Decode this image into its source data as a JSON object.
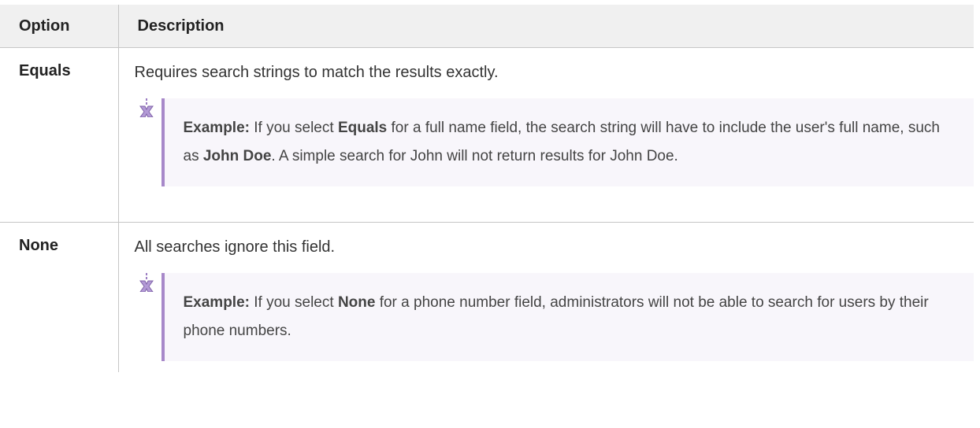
{
  "table": {
    "headers": {
      "option": "Option",
      "description": "Description"
    },
    "rows": [
      {
        "option": "Equals",
        "description": "Requires search strings to match the results exactly.",
        "note": {
          "label": "Example:",
          "t1": " If you select ",
          "b1": "Equals",
          "t2": " for a full name field, the search string will have to include the user's full name, such as ",
          "b2": "John Doe",
          "t3": ". A simple search for John will not return results for John Doe."
        }
      },
      {
        "option": "None",
        "description": "All searches ignore this field.",
        "note": {
          "label": "Example:",
          "t1": " If you select ",
          "b1": "None",
          "t2": " for a phone number field, administrators will not be able to search for users by their phone numbers."
        }
      }
    ]
  },
  "icons": {
    "note": "example-note-icon"
  },
  "colors": {
    "note_border": "#a788c9",
    "note_background": "#f8f6fb",
    "header_background": "#f0f0f0"
  }
}
